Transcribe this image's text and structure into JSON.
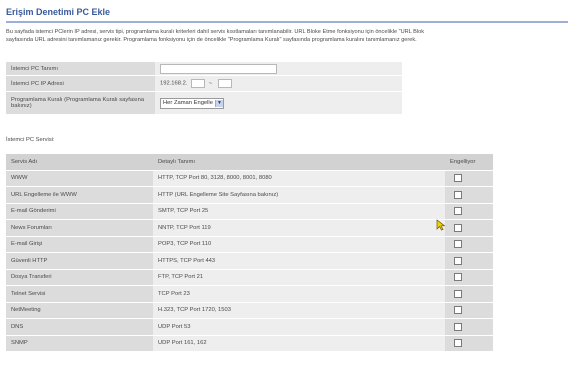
{
  "page": {
    "title": "Erişim Denetimi PC Ekle",
    "description_line1": "Bu sayfada istemci PClerin IP adresi, servis tipi, programlama kuralı kriterleri dahil servis kısıtlamaları tanımlanabilir. URL Bloke Etme fonksiyonu için öncelikle \"URL Blok",
    "description_line2": "sayfasında URL adresini tanımlamanız gerekir. Programlama fonksiyonu için de öncelikle \"Programlama Kuralı\" sayfasında programlama kuralını tanımlamanız gerek."
  },
  "form": {
    "pc_desc_label": "İstemci PC Tanımı",
    "pc_desc_value": "",
    "ip_label": "İstemci PC IP Adresi",
    "ip_prefix": "192.168.2.",
    "ip_start": "",
    "ip_dash": "~",
    "ip_end": "",
    "schedule_label": "Programlama Kuralı (Programlama Kuralı sayfasına bakınız)",
    "schedule_value": "Her Zaman Engelle"
  },
  "service_section": {
    "label": "İstemci PC Servisi:",
    "headers": {
      "name": "Servis Adı",
      "detail": "Detaylı Tanımı",
      "blocked": "Engelliyor"
    },
    "rows": [
      {
        "name": "WWW",
        "detail": "HTTP, TCP Port 80, 3128, 8000, 8001, 8080",
        "checked": false
      },
      {
        "name": "URL Engelleme ile WWW",
        "detail": "HTTP (URL Engelleme Site Sayfasına bakınız)",
        "checked": false
      },
      {
        "name": "E-mail Gönderimi",
        "detail": "SMTP, TCP Port 25",
        "checked": false
      },
      {
        "name": "News Forumları",
        "detail": "NNTP, TCP Port 119",
        "checked": false
      },
      {
        "name": "E-mail Girişi",
        "detail": "POP3, TCP Port 110",
        "checked": false
      },
      {
        "name": "Güvenli HTTP",
        "detail": "HTTPS, TCP Port 443",
        "checked": false
      },
      {
        "name": "Dosya Transferi",
        "detail": "FTP, TCP Port 21",
        "checked": false
      },
      {
        "name": "Telnet Servisi",
        "detail": "TCP Port 23",
        "checked": false
      },
      {
        "name": "NetMeeting",
        "detail": "H.323, TCP Port 1720, 1503",
        "checked": false
      },
      {
        "name": "DNS",
        "detail": "UDP Port 53",
        "checked": false
      },
      {
        "name": "SNMP",
        "detail": "UDP Port 161, 162",
        "checked": false
      }
    ]
  },
  "colors": {
    "title": "#3a5a9a",
    "label_cell": "#dcdcdc",
    "value_cell": "#eeeeee"
  }
}
